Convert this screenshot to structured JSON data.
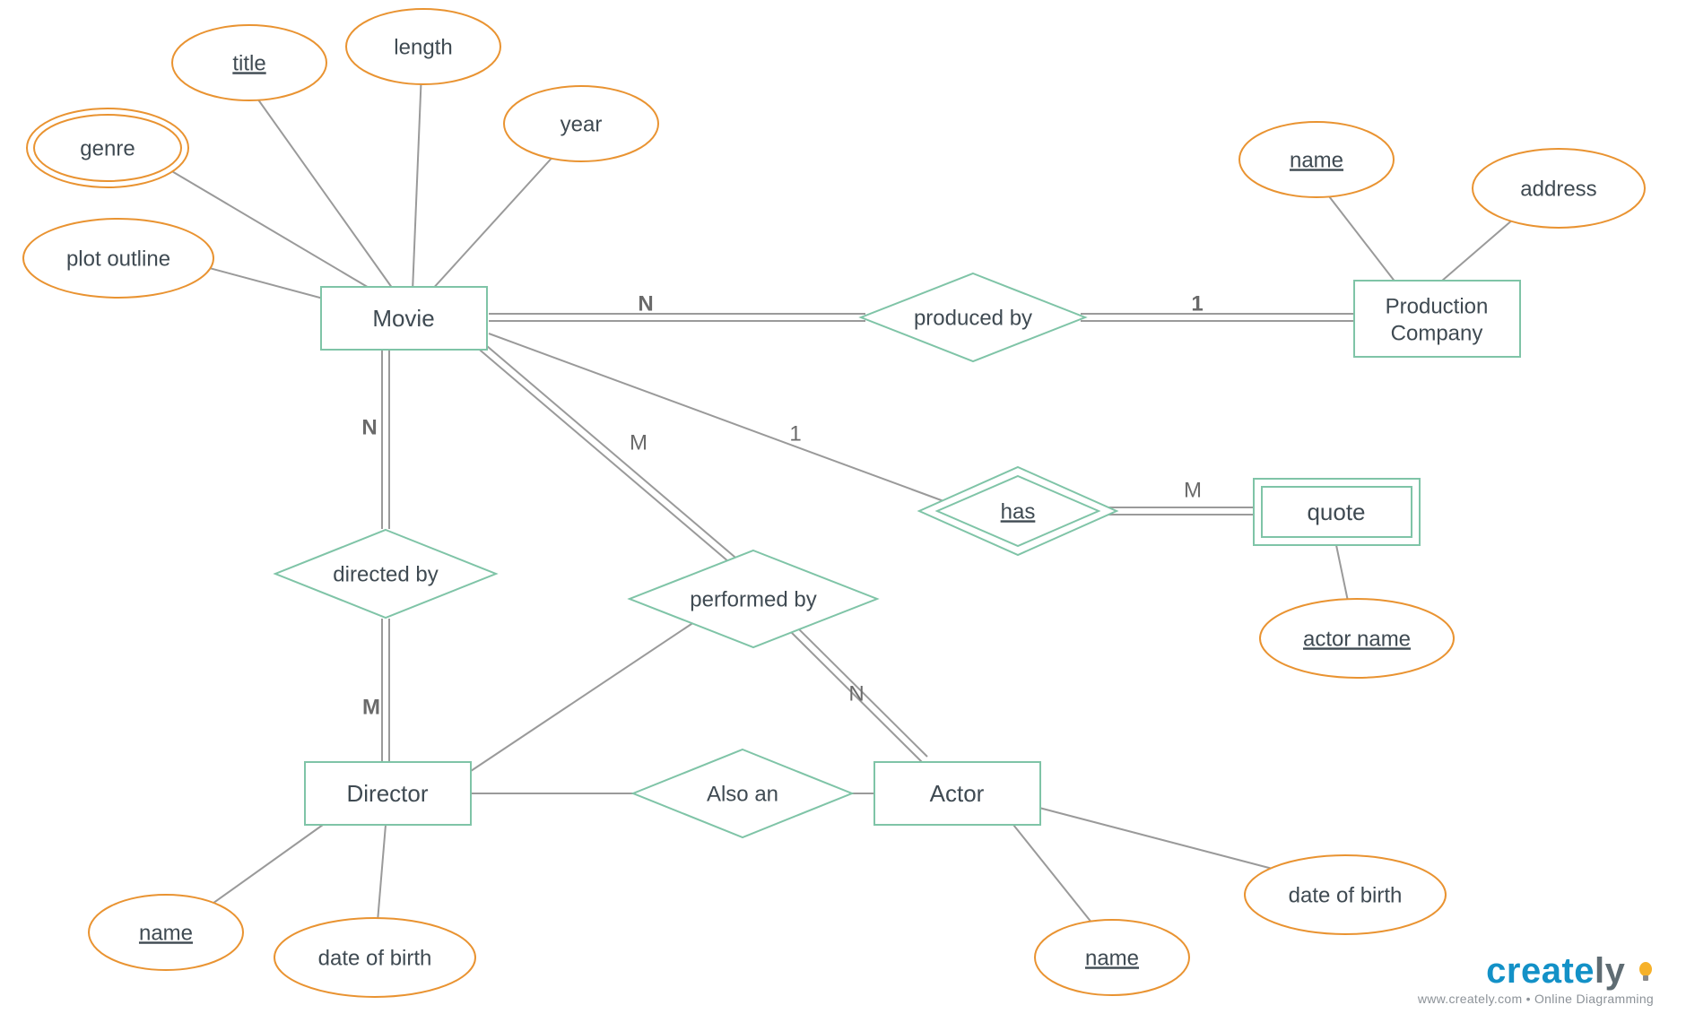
{
  "entities": {
    "movie": "Movie",
    "production_company_line1": "Production",
    "production_company_line2": "Company",
    "director": "Director",
    "actor": "Actor",
    "quote": "quote"
  },
  "relationships": {
    "produced_by": "produced by",
    "directed_by": "directed by",
    "performed_by": "performed by",
    "also_an": "Also an",
    "has": "has"
  },
  "attributes": {
    "genre": "genre",
    "title": "title",
    "length": "length",
    "year": "year",
    "plot_outline": "plot outline",
    "pc_name": "name",
    "pc_address": "address",
    "director_name": "name",
    "director_dob": "date of birth",
    "actor_name": "name",
    "actor_dob": "date of birth",
    "quote_actor_name": "actor name"
  },
  "cardinalities": {
    "movie_produced_n": "N",
    "produced_company_1": "1",
    "movie_directed_n": "N",
    "directed_director_m": "M",
    "movie_performed_m": "M",
    "performed_actor_n": "N",
    "movie_has_1": "1",
    "has_quote_m": "M"
  },
  "branding": {
    "name_part1": "create",
    "name_part2": "ly",
    "tagline": "www.creately.com • Online Diagramming"
  }
}
